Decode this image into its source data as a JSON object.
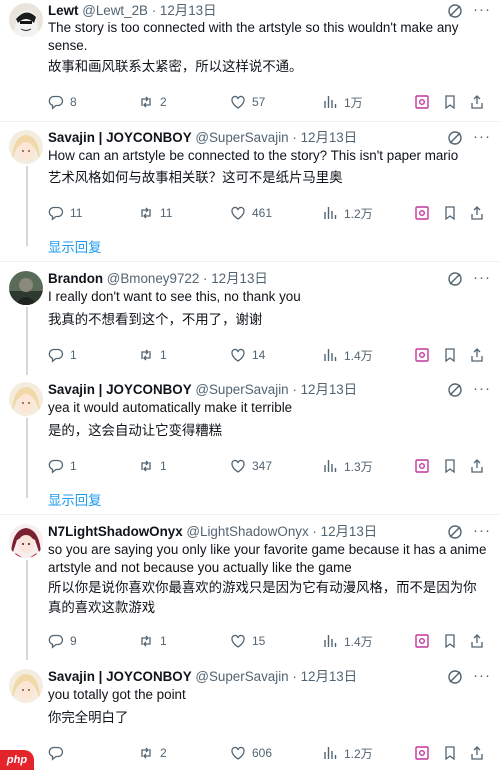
{
  "posts": [
    {
      "name": "Lewt",
      "handle": "@Lewt_2B",
      "dot": "·",
      "date": "12月13日",
      "text": "The story is too connected with the artstyle so this wouldn't make any sense.",
      "translation": "故事和画风联系太紧密，所以这样说不通。",
      "replies": "8",
      "reposts": "2",
      "likes": "57",
      "views": "1万",
      "avatar_icon": "anime-avatar-icon"
    },
    {
      "name": "Savajin | JOYCONBOY",
      "handle": "@SuperSavajin",
      "dot": "·",
      "date": "12月13日",
      "text": "How can an artstyle be connected to the story? This isn't paper mario",
      "translation": "艺术风格如何与故事相关联？这可不是纸片马里奥",
      "replies": "11",
      "reposts": "11",
      "likes": "461",
      "views": "1.2万",
      "avatar_icon": "blonde-anime-avatar-icon"
    },
    {
      "name": "Brandon",
      "handle": "@Bmoney9722",
      "dot": "·",
      "date": "12月13日",
      "text": "I really don't want to see this, no thank you",
      "translation": "我真的不想看到这个，不用了，谢谢",
      "replies": "1",
      "reposts": "1",
      "likes": "14",
      "views": "1.4万",
      "avatar_icon": "dark-avatar-icon"
    },
    {
      "name": "Savajin | JOYCONBOY",
      "handle": "@SuperSavajin",
      "dot": "·",
      "date": "12月13日",
      "text": "yea it would automatically make it terrible",
      "translation": "是的，这会自动让它变得糟糕",
      "replies": "1",
      "reposts": "1",
      "likes": "347",
      "views": "1.3万",
      "avatar_icon": "blonde-anime-avatar-icon"
    },
    {
      "name": "N7LightShadowOnyx",
      "handle": "@LightShadowOnyx",
      "dot": "·",
      "date": "12月13日",
      "text": "so you are saying you only like your favorite game because it has a anime artstyle and not because you actually like the game",
      "translation": "所以你是说你喜欢你最喜欢的游戏只是因为它有动漫风格，而不是因为你真的喜欢这款游戏",
      "replies": "9",
      "reposts": "1",
      "likes": "15",
      "views": "1.4万",
      "avatar_icon": "red-anime-avatar-icon"
    },
    {
      "name": "Savajin | JOYCONBOY",
      "handle": "@SuperSavajin",
      "dot": "·",
      "date": "12月13日",
      "text": "you totally got the point",
      "translation": "你完全明白了",
      "replies": "",
      "reposts": "2",
      "likes": "606",
      "views": "1.2万",
      "avatar_icon": "blonde-anime-avatar-icon"
    }
  ],
  "show_replies_label": "显示回复",
  "watermark": "php",
  "colors": {
    "text": "#0f1419",
    "secondary": "#536471",
    "link": "#1d9bf0",
    "divider": "#eff3f4",
    "thread": "#cfd9de"
  }
}
